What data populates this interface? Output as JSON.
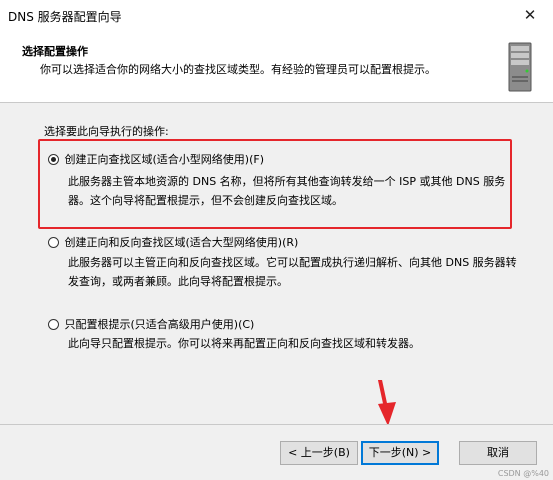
{
  "window": {
    "title": "DNS 服务器配置向导",
    "close_glyph": "✕"
  },
  "header": {
    "title": "选择配置操作",
    "subtitle": "你可以选择适合你的网络大小的查找区域类型。有经验的管理员可以配置根提示。"
  },
  "main": {
    "prompt": "选择要此向导执行的操作:",
    "options": [
      {
        "label": "创建正向查找区域(适合小型网络使用)(F)",
        "checked": true,
        "description": "此服务器主管本地资源的 DNS 名称，但将所有其他查询转发给一个 ISP 或其他 DNS 服务器。这个向导将配置根提示，但不会创建反向查找区域。"
      },
      {
        "label": "创建正向和反向查找区域(适合大型网络使用)(R)",
        "checked": false,
        "description": "此服务器可以主管正向和反向查找区域。它可以配置成执行递归解析、向其他 DNS 服务器转发查询，或两者兼顾。此向导将配置根提示。"
      },
      {
        "label": "只配置根提示(只适合高级用户使用)(C)",
        "checked": false,
        "description": "此向导只配置根提示。你可以将来再配置正向和反向查找区域和转发器。"
      }
    ]
  },
  "footer": {
    "back_label": "< 上一步(B)",
    "next_label": "下一步(N) >",
    "cancel_label": "取消"
  },
  "watermark": "CSDN @%40",
  "colors": {
    "highlight": "#e5262b",
    "focus": "#0078d7"
  }
}
